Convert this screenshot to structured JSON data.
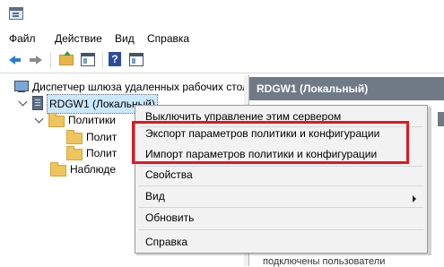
{
  "menubar": {
    "items": [
      "Файл",
      "Действие",
      "Вид",
      "Справка"
    ]
  },
  "toolbar": {
    "icons": [
      "back-arrow-icon",
      "forward-arrow-icon",
      "folder-up-icon",
      "show-hide-tree-icon",
      "help-icon",
      "properties-icon"
    ],
    "help_glyph": "?"
  },
  "tree": {
    "root_label": "Диспетчер шлюза удаленных рабочих стол",
    "server_label": "RDGW1 (Локальный)",
    "policies_label": "Политики",
    "policy_child_1": "Полит",
    "policy_child_2": "Полит",
    "monitoring_label": "Наблюде"
  },
  "right_pane": {
    "header": "RDGW1 (Локальный)",
    "bottom_text": "подключены пользователи"
  },
  "context_menu": {
    "items": [
      "Выключить управление этим сервером",
      "Экспорт параметров политики и конфигурации",
      "Импорт параметров политики и конфигурации",
      "Свойства",
      "Вид",
      "Обновить",
      "Справка"
    ]
  },
  "colors": {
    "highlight": "#e3161f",
    "selection": "#cce8ff",
    "pane_header": "#6f7a86"
  }
}
